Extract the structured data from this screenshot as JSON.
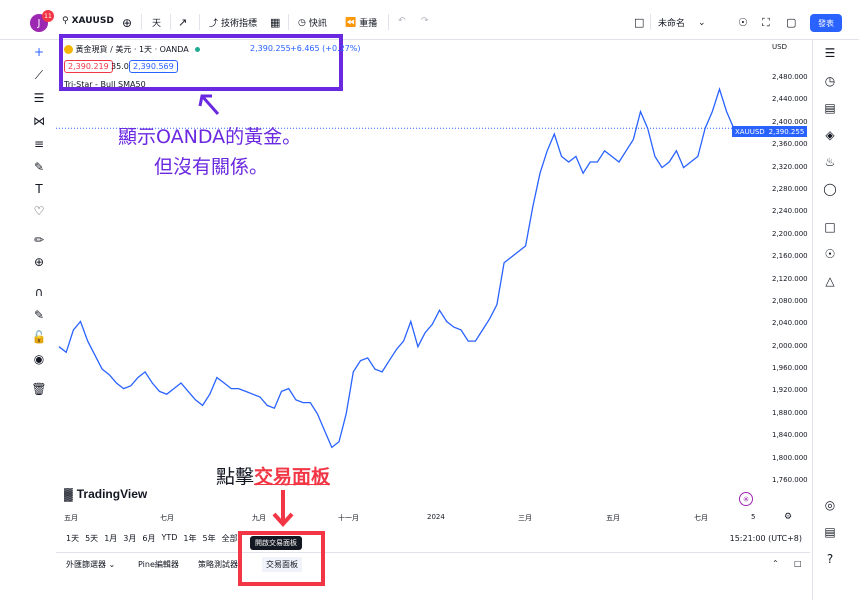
{
  "header": {
    "symbol": "XAUUSD",
    "interval": "天",
    "indicators_label": "技術指標",
    "alerts_label": "快訊",
    "replay_label": "重播",
    "unnamed_label": "未命名",
    "publish_label": "發表",
    "notif_count": "11",
    "avatar_letter": "J"
  },
  "legend": {
    "title": "黃金現貨 / 美元 · 1天 · OANDA",
    "price": "2,390.255",
    "change": "+6.465 (+0.27%)",
    "sell_price": "2,390.219",
    "spread": "35.0",
    "buy_price": "2,390.569",
    "indicator": "Tri-Star - Bull SMA50"
  },
  "annotations": {
    "line1": "顯示OANDA的黃金。",
    "line2": "但沒有關係。",
    "click_prefix": "點擊",
    "click_target": "交易面板"
  },
  "axis": {
    "currency": "USD",
    "last_price_symbol": "XAUUSD",
    "last_price": "2,390.255",
    "time": "15:21:00 (UTC+8)"
  },
  "timeframes": [
    "1天",
    "5天",
    "1月",
    "3月",
    "6月",
    "YTD",
    "1年",
    "5年",
    "全部"
  ],
  "bottom_tabs": {
    "screener": "外匯篩選器",
    "pine": "Pine編輯器",
    "strategy": "策略測試器",
    "trading": "交易面板",
    "tooltip": "開啟交易面板"
  },
  "brand": "TradingView",
  "chart_data": {
    "type": "line",
    "symbol": "XAUUSD",
    "x_ticks": [
      "五月",
      "七月",
      "九月",
      "十一月",
      "2024",
      "三月",
      "五月",
      "七月",
      "5"
    ],
    "y_ticks": [
      "2,480.000",
      "2,440.000",
      "2,400.000",
      "2,360.000",
      "2,320.000",
      "2,280.000",
      "2,240.000",
      "2,200.000",
      "2,160.000",
      "2,120.000",
      "2,080.000",
      "2,040.000",
      "2,000.000",
      "1,960.000",
      "1,920.000",
      "1,880.000",
      "1,840.000",
      "1,800.000",
      "1,760.000"
    ],
    "ylim": [
      1760,
      2480
    ],
    "y": [
      2000,
      1990,
      2030,
      2045,
      2010,
      1985,
      1960,
      1950,
      1935,
      1925,
      1930,
      1945,
      1955,
      1935,
      1920,
      1915,
      1925,
      1935,
      1920,
      1905,
      1895,
      1915,
      1945,
      1935,
      1925,
      1925,
      1920,
      1915,
      1910,
      1895,
      1890,
      1920,
      1925,
      1905,
      1900,
      1900,
      1880,
      1850,
      1820,
      1830,
      1880,
      1955,
      1975,
      1980,
      1960,
      1955,
      1975,
      1995,
      2010,
      2045,
      2000,
      2025,
      2040,
      2065,
      2045,
      2035,
      2030,
      2010,
      2010,
      2030,
      2050,
      2075,
      2150,
      2160,
      2170,
      2180,
      2250,
      2310,
      2350,
      2380,
      2340,
      2330,
      2340,
      2310,
      2330,
      2330,
      2350,
      2340,
      2330,
      2350,
      2370,
      2420,
      2390,
      2340,
      2320,
      2330,
      2350,
      2320,
      2330,
      2340,
      2390,
      2420,
      2460,
      2420,
      2390,
      2390
    ]
  }
}
